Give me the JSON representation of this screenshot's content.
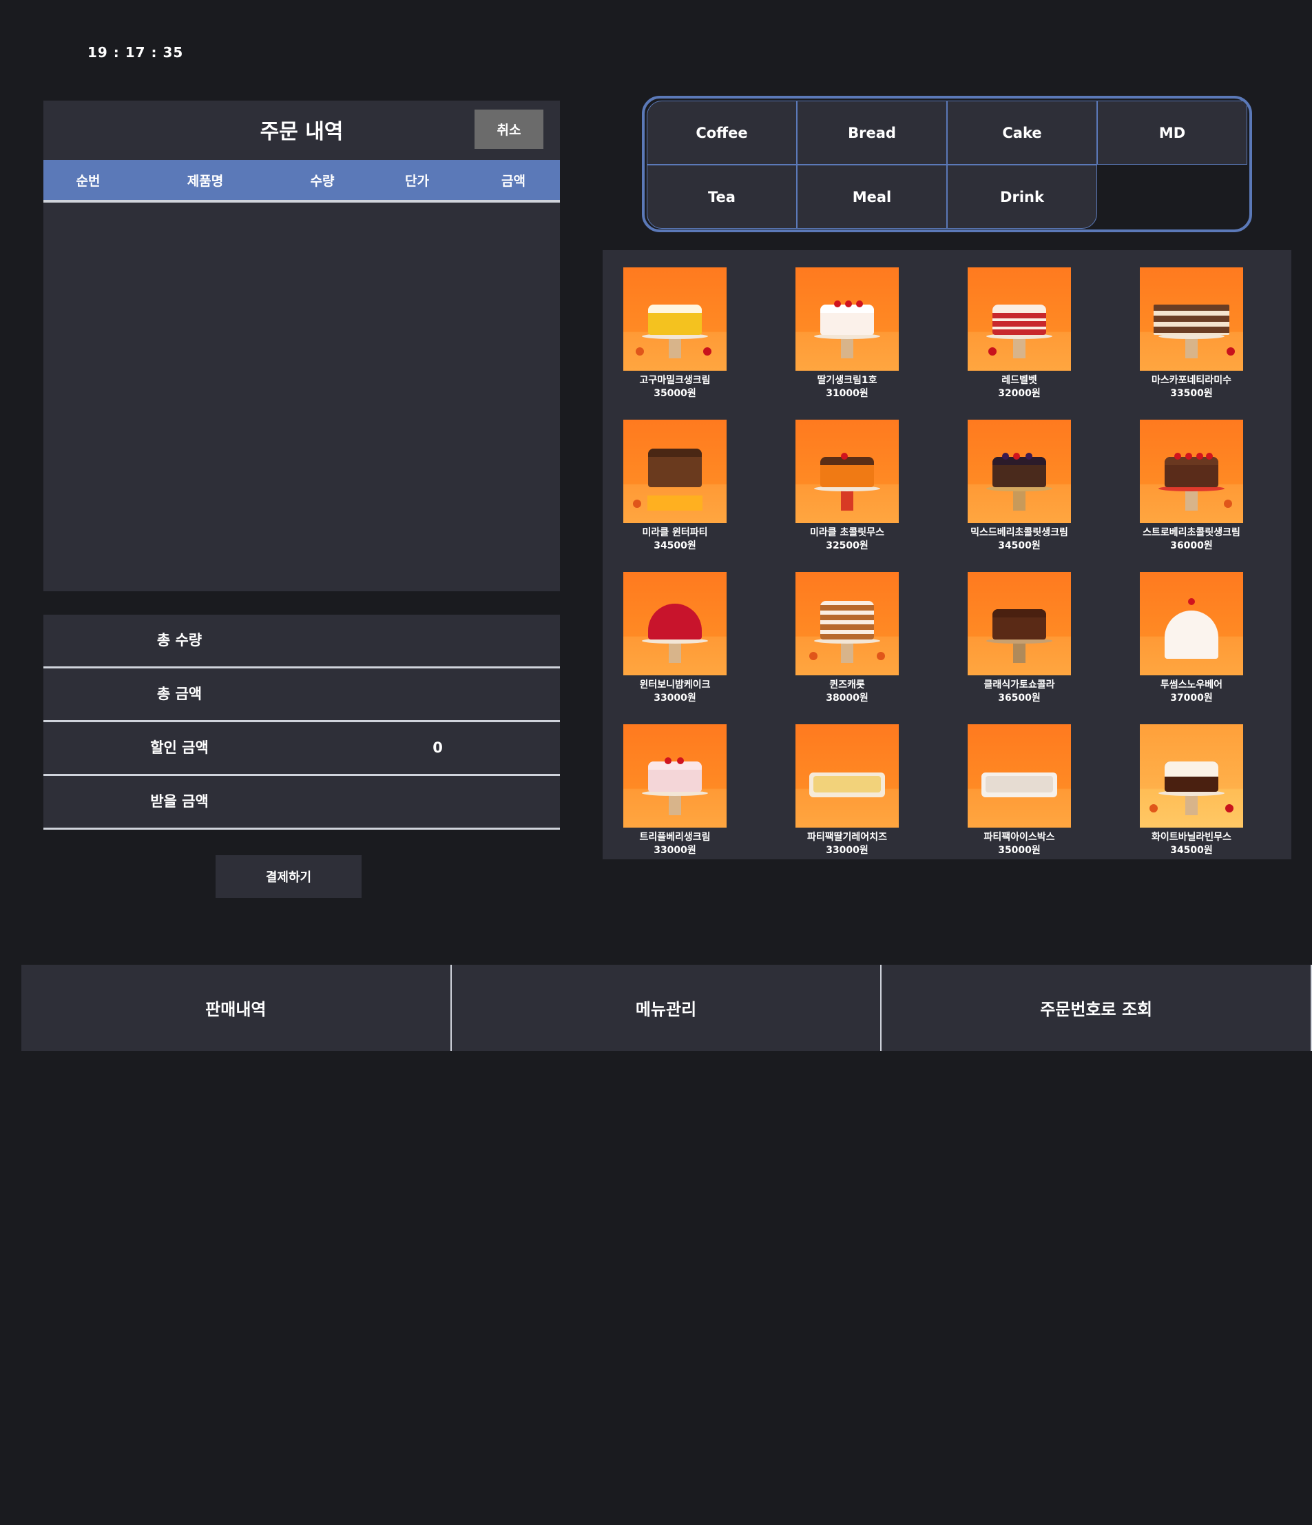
{
  "clock": "19 : 17 : 35",
  "order": {
    "title": "주문 내역",
    "cancel_label": "취소",
    "columns": [
      "순번",
      "제품명",
      "수량",
      "단가",
      "금액"
    ]
  },
  "summary": {
    "total_qty_label": "총 수량",
    "total_qty_value": "",
    "total_amount_label": "총 금액",
    "total_amount_value": "",
    "discount_label": "할인 금액",
    "discount_value": "0",
    "receive_label": "받을 금액",
    "receive_value": ""
  },
  "pay_label": "결제하기",
  "categories": [
    "Coffee",
    "Bread",
    "Cake",
    "MD",
    "Tea",
    "Meal",
    "Drink"
  ],
  "products": [
    {
      "name": "고구마밀크생크림",
      "price": "35000원"
    },
    {
      "name": "딸기생크림1호",
      "price": "31000원"
    },
    {
      "name": "레드벨벳",
      "price": "32000원"
    },
    {
      "name": "마스카포네티라미수",
      "price": "33500원"
    },
    {
      "name": "미라클 윈터파티",
      "price": "34500원"
    },
    {
      "name": "미라클 초콜릿무스",
      "price": "32500원"
    },
    {
      "name": "믹스드베리초콜릿생크림",
      "price": "34500원"
    },
    {
      "name": "스트로베리초콜릿생크림",
      "price": "36000원"
    },
    {
      "name": "윈터보니밤케이크",
      "price": "33000원"
    },
    {
      "name": "퀸즈캐롯",
      "price": "38000원"
    },
    {
      "name": "클래식가토쇼콜라",
      "price": "36500원"
    },
    {
      "name": "투썸스노우베어",
      "price": "37000원"
    },
    {
      "name": "트리플베리생크림",
      "price": "33000원"
    },
    {
      "name": "파티팩딸기레어치즈",
      "price": "33000원"
    },
    {
      "name": "파티팩아이스박스",
      "price": "35000원"
    },
    {
      "name": "화이트바닐라빈무스",
      "price": "34500원"
    }
  ],
  "nav": [
    "판매내역",
    "메뉴관리",
    "주문번호로 조회"
  ],
  "colors": {
    "background": "#1a1b1f",
    "panel": "#2e2f38",
    "accent_blue": "#5b79b8",
    "cancel_gray": "#6b6b6b",
    "product_bg_orange": "#ff7a1f"
  }
}
